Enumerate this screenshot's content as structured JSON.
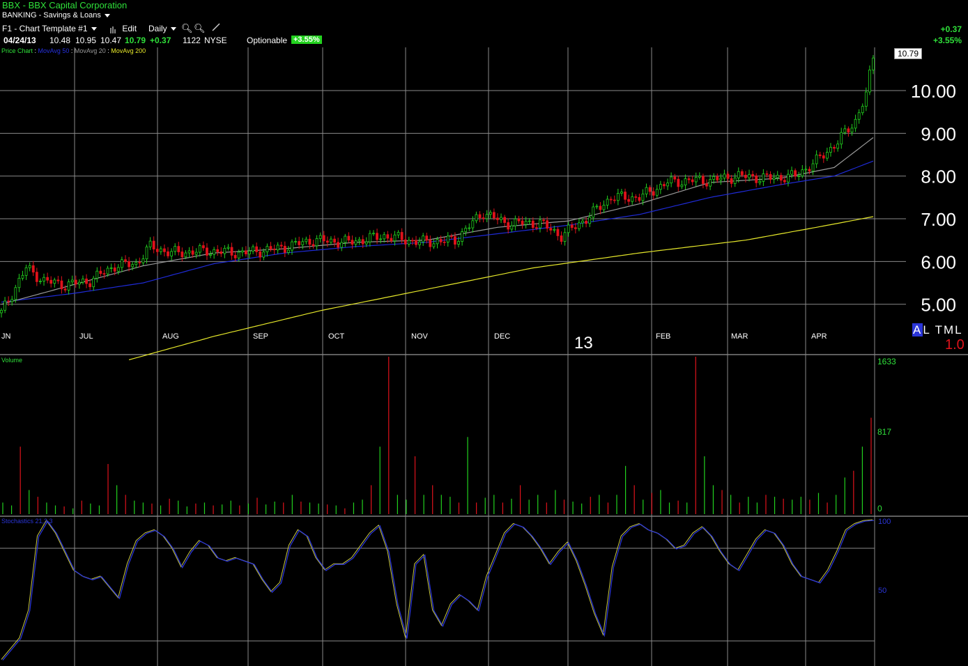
{
  "header": {
    "symbol_line": "BBX - BBX Capital Corporation",
    "industry": "BANKING - Savings & Loans",
    "template": "F1 - Chart Template #1",
    "edit_label": "Edit",
    "period_label": "Daily",
    "date": "04/24/13",
    "open": "10.48",
    "high": "10.95",
    "low": "10.47",
    "close": "10.79",
    "change": "+0.37",
    "volume": "1122",
    "exchange": "NYSE",
    "optionable": "Optionable",
    "pct_badge": "+3.55%",
    "right_change": "+0.37",
    "right_pct": "+3.55%"
  },
  "legend": {
    "price_chart": "Price Chart",
    "ma50": "MovAvg 50",
    "ma20": "MovAvg 20",
    "ma200": "MovAvg 200"
  },
  "price_box": "10.79",
  "side_tabs": {
    "a": "A",
    "l": "L",
    "t": "T",
    "m": "M",
    "l2": "L"
  },
  "scale_factor": "1.0",
  "year_label": "13",
  "volume_panel": {
    "title": "Volume",
    "max": "1633",
    "mid": "817",
    "zero": "0"
  },
  "stoch_panel": {
    "title": "Stochastics 21,3,3",
    "top": "100",
    "mid": "50"
  },
  "colors": {
    "up": "#22d21e",
    "down": "#e0121b",
    "ma50": "#1f2bd8",
    "ma20": "#9a9a9a",
    "ma200": "#e6e82a",
    "grid": "#8a8a8a"
  },
  "chart_data": [
    {
      "type": "candlestick",
      "title": "BBX - BBX Capital Corporation",
      "months": [
        "JN",
        "JUL",
        "AUG",
        "SEP",
        "OCT",
        "NOV",
        "DEC",
        "FEB",
        "MAR",
        "APR"
      ],
      "y_ticks": [
        "5.00",
        "6.00",
        "7.00",
        "8.00",
        "9.00",
        "10.00"
      ],
      "ylim": [
        4.5,
        10.9
      ],
      "close_series": [
        {
          "x": 0,
          "y": 4.8
        },
        {
          "x": 7,
          "y": 5.85
        },
        {
          "x": 12,
          "y": 5.55
        },
        {
          "x": 18,
          "y": 5.45
        },
        {
          "x": 25,
          "y": 5.55
        },
        {
          "x": 32,
          "y": 5.9
        },
        {
          "x": 38,
          "y": 5.95
        },
        {
          "x": 42,
          "y": 6.35
        },
        {
          "x": 48,
          "y": 6.2
        },
        {
          "x": 58,
          "y": 6.25
        },
        {
          "x": 68,
          "y": 6.2
        },
        {
          "x": 78,
          "y": 6.3
        },
        {
          "x": 88,
          "y": 6.5
        },
        {
          "x": 98,
          "y": 6.45
        },
        {
          "x": 108,
          "y": 6.6
        },
        {
          "x": 118,
          "y": 6.45
        },
        {
          "x": 128,
          "y": 6.5
        },
        {
          "x": 136,
          "y": 7.15
        },
        {
          "x": 142,
          "y": 6.9
        },
        {
          "x": 152,
          "y": 6.9
        },
        {
          "x": 158,
          "y": 6.6
        },
        {
          "x": 165,
          "y": 7.0
        },
        {
          "x": 172,
          "y": 7.5
        },
        {
          "x": 180,
          "y": 7.5
        },
        {
          "x": 188,
          "y": 7.85
        },
        {
          "x": 195,
          "y": 7.9
        },
        {
          "x": 200,
          "y": 7.9
        },
        {
          "x": 208,
          "y": 8.0
        },
        {
          "x": 216,
          "y": 7.95
        },
        {
          "x": 224,
          "y": 8.0
        },
        {
          "x": 230,
          "y": 8.35
        },
        {
          "x": 236,
          "y": 8.8
        },
        {
          "x": 241,
          "y": 9.3
        },
        {
          "x": 244,
          "y": 9.9
        },
        {
          "x": 246,
          "y": 10.79
        }
      ],
      "ma20": [
        {
          "x": 0,
          "y": 5.0
        },
        {
          "x": 20,
          "y": 5.45
        },
        {
          "x": 40,
          "y": 5.9
        },
        {
          "x": 60,
          "y": 6.2
        },
        {
          "x": 80,
          "y": 6.3
        },
        {
          "x": 100,
          "y": 6.45
        },
        {
          "x": 120,
          "y": 6.5
        },
        {
          "x": 140,
          "y": 6.8
        },
        {
          "x": 160,
          "y": 6.95
        },
        {
          "x": 180,
          "y": 7.35
        },
        {
          "x": 200,
          "y": 7.85
        },
        {
          "x": 220,
          "y": 7.95
        },
        {
          "x": 235,
          "y": 8.2
        },
        {
          "x": 246,
          "y": 8.9
        }
      ],
      "ma50": [
        {
          "x": 0,
          "y": 5.05
        },
        {
          "x": 20,
          "y": 5.25
        },
        {
          "x": 40,
          "y": 5.5
        },
        {
          "x": 60,
          "y": 5.95
        },
        {
          "x": 80,
          "y": 6.2
        },
        {
          "x": 100,
          "y": 6.35
        },
        {
          "x": 120,
          "y": 6.45
        },
        {
          "x": 140,
          "y": 6.65
        },
        {
          "x": 160,
          "y": 6.85
        },
        {
          "x": 180,
          "y": 7.1
        },
        {
          "x": 200,
          "y": 7.5
        },
        {
          "x": 220,
          "y": 7.8
        },
        {
          "x": 235,
          "y": 8.0
        },
        {
          "x": 246,
          "y": 8.35
        }
      ],
      "ma200": [
        {
          "x": 36,
          "y": 3.7
        },
        {
          "x": 60,
          "y": 4.25
        },
        {
          "x": 90,
          "y": 4.85
        },
        {
          "x": 120,
          "y": 5.35
        },
        {
          "x": 150,
          "y": 5.85
        },
        {
          "x": 180,
          "y": 6.2
        },
        {
          "x": 210,
          "y": 6.5
        },
        {
          "x": 230,
          "y": 6.8
        },
        {
          "x": 246,
          "y": 7.05
        }
      ]
    },
    {
      "type": "bar",
      "title": "Volume",
      "ylim": [
        0,
        1633
      ],
      "values": [
        120,
        90,
        700,
        250,
        180,
        120,
        90,
        80,
        60,
        140,
        110,
        90,
        520,
        300,
        200,
        140,
        120,
        110,
        90,
        160,
        140,
        80,
        110,
        120,
        90,
        100,
        140,
        90,
        110,
        170,
        100,
        130,
        120,
        200,
        130,
        120,
        110,
        100,
        90,
        60,
        120,
        150,
        300,
        700,
        1633,
        200,
        150,
        600,
        200,
        300,
        200,
        180,
        120,
        800,
        120,
        170,
        200,
        120,
        160,
        300,
        150,
        200,
        120,
        250,
        150,
        130,
        110,
        180,
        200,
        120,
        200,
        500,
        300,
        150,
        220,
        250,
        120,
        140,
        120,
        1633,
        600,
        300,
        250,
        200,
        120,
        180,
        120,
        200,
        180,
        160,
        150,
        180,
        150,
        220,
        120,
        200,
        380,
        450,
        700,
        1000
      ]
    },
    {
      "type": "line",
      "title": "Stochastics 21,3,3",
      "ylim": [
        0,
        100
      ],
      "values": [
        8,
        15,
        22,
        40,
        88,
        98,
        90,
        78,
        66,
        62,
        60,
        62,
        55,
        48,
        70,
        85,
        90,
        92,
        88,
        80,
        68,
        78,
        85,
        82,
        74,
        72,
        74,
        72,
        70,
        60,
        52,
        58,
        82,
        92,
        88,
        74,
        66,
        70,
        70,
        74,
        82,
        90,
        95,
        78,
        44,
        22,
        70,
        76,
        40,
        30,
        44,
        50,
        46,
        40,
        62,
        76,
        90,
        96,
        94,
        88,
        80,
        70,
        78,
        84,
        72,
        56,
        38,
        24,
        68,
        88,
        94,
        96,
        92,
        90,
        86,
        80,
        82,
        90,
        94,
        88,
        78,
        70,
        66,
        76,
        86,
        92,
        90,
        82,
        70,
        62,
        60,
        58,
        66,
        78,
        92,
        96,
        98,
        100
      ]
    }
  ]
}
